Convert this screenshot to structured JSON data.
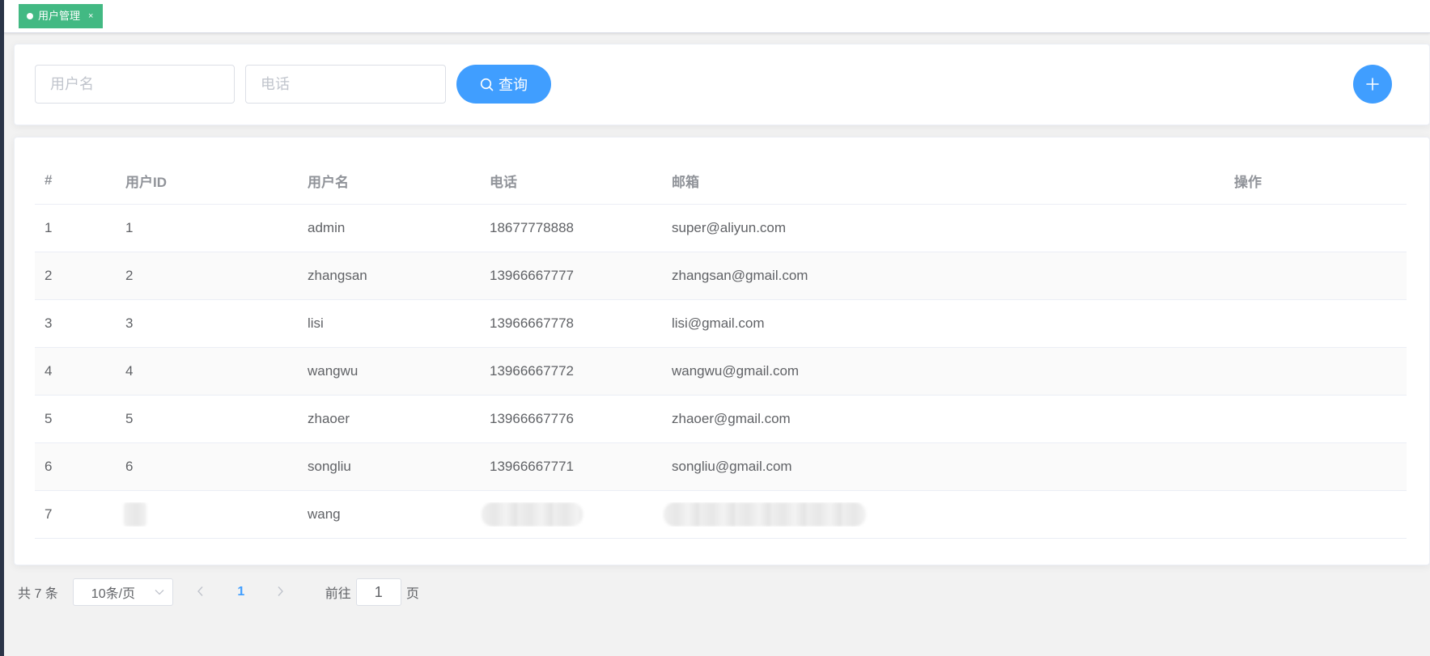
{
  "tags": [
    {
      "label": "用户管理",
      "close": "×",
      "color": "#42b983"
    }
  ],
  "search": {
    "username_placeholder": "用户名",
    "phone_placeholder": "电话",
    "search_label": "查询",
    "search_icon": "search-icon",
    "add_icon": "plus-icon",
    "accent": "#409eff"
  },
  "table": {
    "columns": [
      "#",
      "用户ID",
      "用户名",
      "电话",
      "邮箱",
      "操作"
    ],
    "rows": [
      {
        "index": "1",
        "id": "1",
        "username": "admin",
        "phone": "18677778888",
        "email": "super@aliyun.com"
      },
      {
        "index": "2",
        "id": "2",
        "username": "zhangsan",
        "phone": "13966667777",
        "email": "zhangsan@gmail.com"
      },
      {
        "index": "3",
        "id": "3",
        "username": "lisi",
        "phone": "13966667778",
        "email": "lisi@gmail.com"
      },
      {
        "index": "4",
        "id": "4",
        "username": "wangwu",
        "phone": "13966667772",
        "email": "wangwu@gmail.com"
      },
      {
        "index": "5",
        "id": "5",
        "username": "zhaoer",
        "phone": "13966667776",
        "email": "zhaoer@gmail.com"
      },
      {
        "index": "6",
        "id": "6",
        "username": "songliu",
        "phone": "13966667771",
        "email": "songliu@gmail.com"
      },
      {
        "index": "7",
        "id": "",
        "username": "wang",
        "phone": "",
        "email": ""
      }
    ]
  },
  "pagination": {
    "total_text": "共 7 条",
    "page_size": "10条/页",
    "prev_icon": "chevron-left-icon",
    "next_icon": "chevron-right-icon",
    "current_page": "1",
    "goto_label": "前往",
    "goto_value": "1",
    "goto_suffix": "页"
  }
}
